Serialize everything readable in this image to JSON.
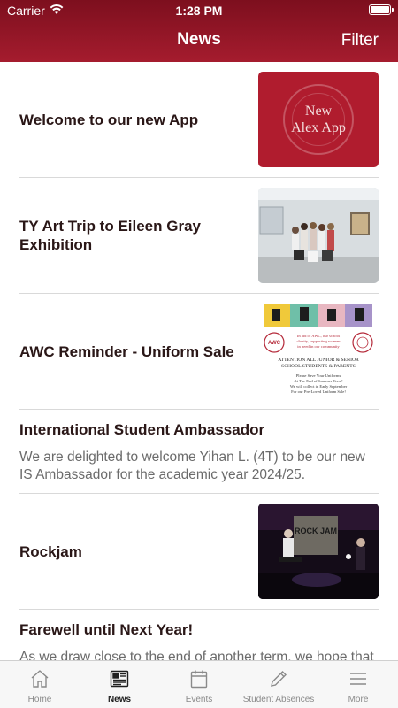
{
  "status_bar": {
    "carrier": "Carrier",
    "time": "1:28 PM"
  },
  "header": {
    "title": "News",
    "filter_label": "Filter"
  },
  "news": [
    {
      "title": "Welcome to our new App",
      "thumb_text_1": "New",
      "thumb_text_2": "Alex App"
    },
    {
      "title": "TY Art Trip to Eileen Gray Exhibition"
    },
    {
      "title": "AWC Reminder - Uniform Sale",
      "flyer": {
        "badge": "AWC",
        "charity_line_1": "In aid of AWC, our school",
        "charity_line_2": "charity, supporting women",
        "charity_line_3": "in need in our community",
        "attention_1": "ATTENTION ALL JUNIOR & SENIOR",
        "attention_2": "SCHOOL STUDENTS & PARENTS",
        "line_1": "Please Save Your Uniforms",
        "line_2": "At The End of Summer Term!",
        "line_3": "We will collect in Early September",
        "line_4": "For our Pre-Loved Uniform Sale!"
      }
    },
    {
      "title": "International Student Ambassador",
      "body": "We are delighted to welcome Yihan L. (4T) to be our new IS Ambassador for the academic year 2024/25."
    },
    {
      "title": "Rockjam",
      "banner_text": "ROCK JAM"
    },
    {
      "title": "Farewell until Next Year!",
      "body": "As we draw close to the end of another term, we hope that"
    }
  ],
  "tabs": [
    {
      "label": "Home",
      "icon": "home-icon"
    },
    {
      "label": "News",
      "icon": "newspaper-icon"
    },
    {
      "label": "Events",
      "icon": "calendar-icon"
    },
    {
      "label": "Student Absences",
      "icon": "pencil-icon"
    },
    {
      "label": "More",
      "icon": "menu-icon"
    }
  ],
  "active_tab": "News",
  "colors": {
    "brand": "#a51c2e",
    "brand_dark": "#7d0f1e",
    "tab_active": "#1f1f1f",
    "tab_inactive": "#8a8a8a"
  }
}
